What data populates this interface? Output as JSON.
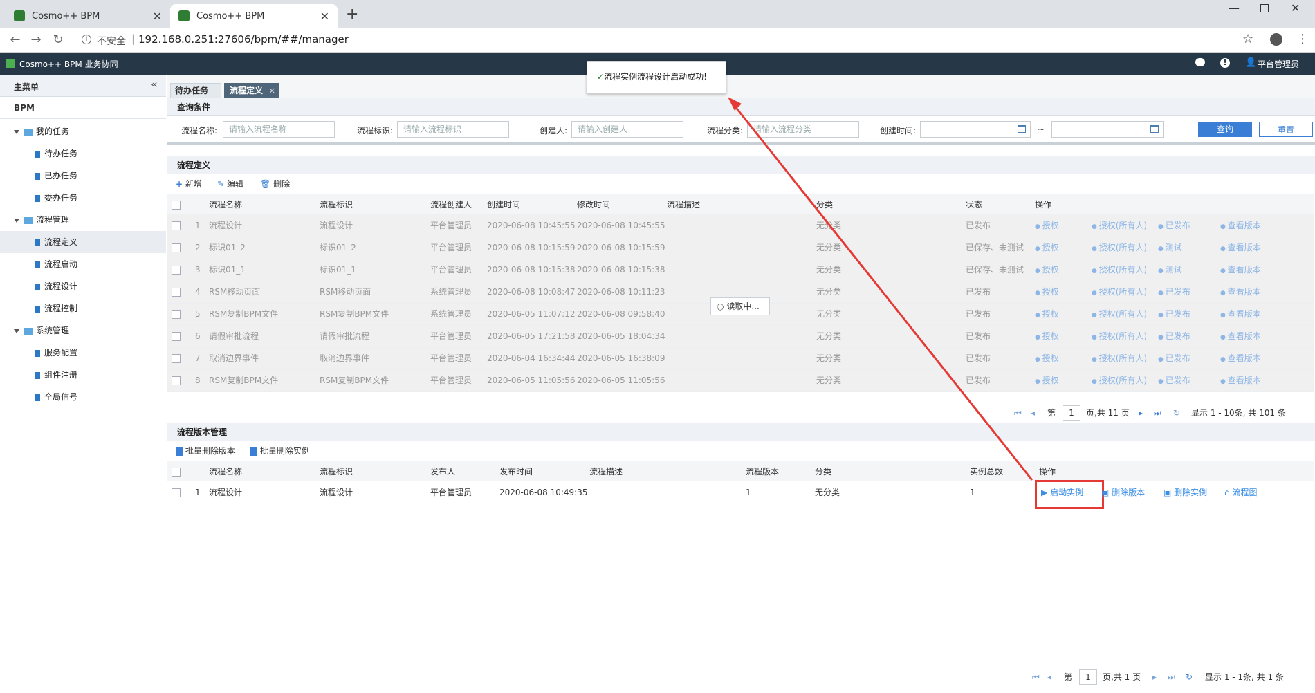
{
  "browser": {
    "tabs": [
      {
        "title": "Cosmo++ BPM"
      },
      {
        "title": "Cosmo++ BPM"
      }
    ],
    "security_label": "不安全",
    "url": "192.168.0.251:27606/bpm/##/manager"
  },
  "app": {
    "title": "Cosmo++ BPM 业务协同",
    "user": "平台管理员"
  },
  "toast": "流程实例流程设计启动成功!",
  "loading": "读取中...",
  "sidebar": {
    "header": "主菜单",
    "section": "BPM",
    "groups": [
      {
        "label": "我的任务",
        "items": [
          {
            "label": "待办任务"
          },
          {
            "label": "已办任务"
          },
          {
            "label": "委办任务"
          }
        ]
      },
      {
        "label": "流程管理",
        "items": [
          {
            "label": "流程定义"
          },
          {
            "label": "流程启动"
          },
          {
            "label": "流程设计"
          },
          {
            "label": "流程控制"
          }
        ]
      },
      {
        "label": "系统管理",
        "items": [
          {
            "label": "服务配置"
          },
          {
            "label": "组件注册"
          },
          {
            "label": "全局信号"
          }
        ]
      }
    ]
  },
  "content_tabs": [
    {
      "label": "待办任务"
    },
    {
      "label": "流程定义"
    }
  ],
  "query": {
    "title": "查询条件",
    "fields": [
      {
        "label": "流程名称:",
        "placeholder": "请输入流程名称"
      },
      {
        "label": "流程标识:",
        "placeholder": "请输入流程标识"
      },
      {
        "label": "创建人:",
        "placeholder": "请输入创建人"
      },
      {
        "label": "流程分类:",
        "placeholder": "请输入流程分类"
      }
    ],
    "created_label": "创建时间:",
    "range_sep": "~",
    "search_btn": "查询",
    "reset_btn": "重置"
  },
  "definitions": {
    "title": "流程定义",
    "toolbar": {
      "add": "新增",
      "edit": "编辑",
      "delete": "删除"
    },
    "columns": [
      "流程名称",
      "流程标识",
      "流程创建人",
      "创建时间",
      "修改时间",
      "流程描述",
      "分类",
      "状态",
      "操作"
    ],
    "rows": [
      {
        "no": "1",
        "name": "流程设计",
        "key": "流程设计",
        "creator": "平台管理员",
        "created": "2020-06-08 10:45:55",
        "modified": "2020-06-08 10:45:55",
        "desc": "",
        "category": "无分类",
        "status": "已发布",
        "ops": [
          "授权",
          "授权(所有人)",
          "已发布",
          "查看版本"
        ]
      },
      {
        "no": "2",
        "name": "标识01_2",
        "key": "标识01_2",
        "creator": "平台管理员",
        "created": "2020-06-08 10:15:59",
        "modified": "2020-06-08 10:15:59",
        "desc": "",
        "category": "无分类",
        "status": "已保存、未测试",
        "ops": [
          "授权",
          "授权(所有人)",
          "测试",
          "查看版本"
        ]
      },
      {
        "no": "3",
        "name": "标识01_1",
        "key": "标识01_1",
        "creator": "平台管理员",
        "created": "2020-06-08 10:15:38",
        "modified": "2020-06-08 10:15:38",
        "desc": "",
        "category": "无分类",
        "status": "已保存、未测试",
        "ops": [
          "授权",
          "授权(所有人)",
          "测试",
          "查看版本"
        ]
      },
      {
        "no": "4",
        "name": "RSM移动页面",
        "key": "RSM移动页面",
        "creator": "系统管理员",
        "created": "2020-06-08 10:08:47",
        "modified": "2020-06-08 10:11:23",
        "desc": "",
        "category": "无分类",
        "status": "已发布",
        "ops": [
          "授权",
          "授权(所有人)",
          "已发布",
          "查看版本"
        ]
      },
      {
        "no": "5",
        "name": "RSM复制BPM文件",
        "key": "RSM复制BPM文件",
        "creator": "系统管理员",
        "created": "2020-06-05 11:07:12",
        "modified": "2020-06-08 09:58:40",
        "desc": "",
        "category": "无分类",
        "status": "已发布",
        "ops": [
          "授权",
          "授权(所有人)",
          "已发布",
          "查看版本"
        ]
      },
      {
        "no": "6",
        "name": "请假审批流程",
        "key": "请假审批流程",
        "creator": "平台管理员",
        "created": "2020-06-05 17:21:58",
        "modified": "2020-06-05 18:04:34",
        "desc": "",
        "category": "无分类",
        "status": "已发布",
        "ops": [
          "授权",
          "授权(所有人)",
          "已发布",
          "查看版本"
        ]
      },
      {
        "no": "7",
        "name": "取消边界事件",
        "key": "取消边界事件",
        "creator": "平台管理员",
        "created": "2020-06-04 16:34:44",
        "modified": "2020-06-05 16:38:09",
        "desc": "",
        "category": "无分类",
        "status": "已发布",
        "ops": [
          "授权",
          "授权(所有人)",
          "已发布",
          "查看版本"
        ]
      },
      {
        "no": "8",
        "name": "RSM复制BPM文件",
        "key": "RSM复制BPM文件",
        "creator": "平台管理员",
        "created": "2020-06-05 11:05:56",
        "modified": "2020-06-05 11:05:56",
        "desc": "",
        "category": "无分类",
        "status": "已发布",
        "ops": [
          "授权",
          "授权(所有人)",
          "已发布",
          "查看版本"
        ]
      }
    ],
    "pager": {
      "page_prefix": "第",
      "page": "1",
      "page_suffix": "页,共 11 页",
      "summary": "显示 1 - 10条, 共 101 条"
    }
  },
  "versions": {
    "title": "流程版本管理",
    "toolbar": {
      "batch_delete_version": "批量删除版本",
      "batch_delete_instance": "批量删除实例"
    },
    "columns": [
      "流程名称",
      "流程标识",
      "发布人",
      "发布时间",
      "流程描述",
      "流程版本",
      "分类",
      "实例总数",
      "操作"
    ],
    "rows": [
      {
        "no": "1",
        "name": "流程设计",
        "key": "流程设计",
        "publisher": "平台管理员",
        "published": "2020-06-08 10:49:35",
        "desc": "",
        "version": "1",
        "category": "无分类",
        "instances": "1",
        "ops": [
          "启动实例",
          "删除版本",
          "删除实例",
          "流程图"
        ]
      }
    ],
    "pager": {
      "page_prefix": "第",
      "page": "1",
      "page_suffix": "页,共 1 页",
      "summary": "显示 1 - 1条, 共 1 条"
    }
  },
  "colors": {
    "header_bg": "#263747",
    "accent": "#3a8ee6",
    "highlight": "#e53935"
  }
}
